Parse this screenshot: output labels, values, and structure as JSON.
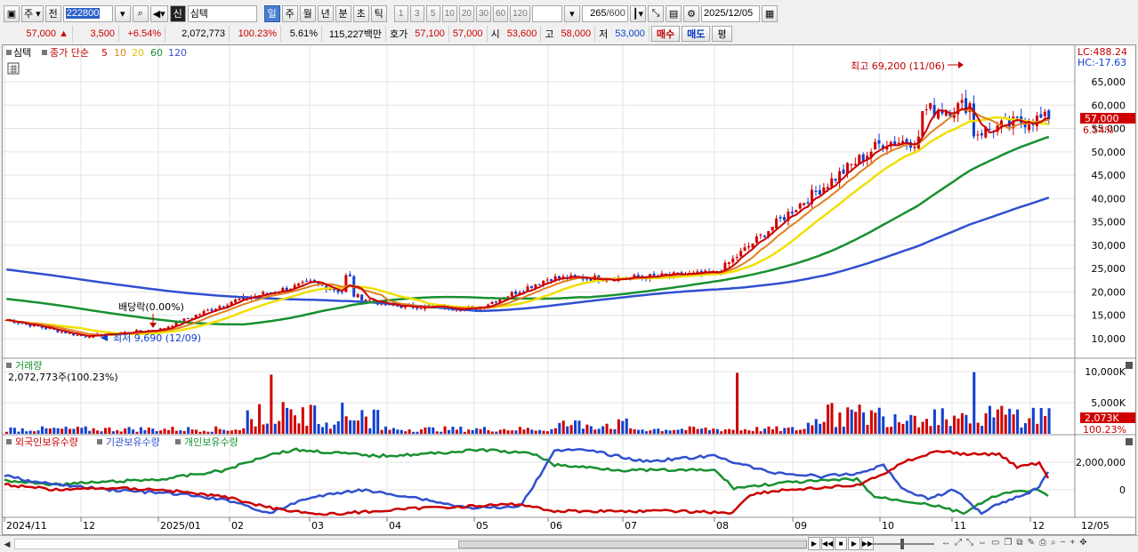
{
  "toolbar": {
    "period_type": "주",
    "prev_label": "전",
    "code": "222800",
    "market_badge": "신",
    "stock_name": "심텍",
    "period_buttons": [
      "일",
      "주",
      "월",
      "년",
      "분",
      "초",
      "틱"
    ],
    "active_period": "일",
    "interval_buttons": [
      "1",
      "3",
      "5",
      "10",
      "20",
      "30",
      "60",
      "120"
    ],
    "count": "265",
    "count_max": "/600",
    "date": "2025/12/05"
  },
  "quote": {
    "price": "57,000",
    "arrow": "▲",
    "change": "3,500",
    "change_pct": "+6.54%",
    "volume": "2,072,773",
    "volume_ratio": "100.23%",
    "turnover": "5.61%",
    "amount": "115,227백만",
    "ask_label": "호가",
    "ask": "57,100",
    "bid": "57,000",
    "open_label": "시",
    "open": "53,600",
    "high_label": "고",
    "high": "58,000",
    "low_label": "저",
    "low": "53,000",
    "buy_label": "매수",
    "sell_label": "매도",
    "eval_label": "평"
  },
  "price_panel": {
    "legend_name": "심텍",
    "legend_ma_title": "종가 단순",
    "ma_periods": [
      {
        "label": "5",
        "color": "#cc0000"
      },
      {
        "label": "10",
        "color": "#e08020"
      },
      {
        "label": "20",
        "color": "#e0d000"
      },
      {
        "label": "60",
        "color": "#189030"
      },
      {
        "label": "120",
        "color": "#3050d0"
      }
    ],
    "lc_label": "LC:488.24",
    "hc_label": "HC:-17.63",
    "current_price_tag": "57,000",
    "current_pct_tag": "6.54%",
    "high_annotation": "최고 69,200 (11/06)",
    "low_annotation": "최저 9,690 (12/09)",
    "dividend_annotation": "배당락(0.00%)",
    "y_ticks": [
      "65,000",
      "60,000",
      "55,000",
      "50,000",
      "45,000",
      "40,000",
      "35,000",
      "30,000",
      "25,000",
      "20,000",
      "15,000",
      "10,000"
    ]
  },
  "volume_panel": {
    "title": "거래량",
    "value_label": "2,072,773주(100.23%)",
    "y_ticks": [
      "10,000K",
      "5,000K"
    ],
    "current_tag": "2,073K",
    "current_pct": "100.23%"
  },
  "holding_panel": {
    "legends": [
      {
        "label": "외국인보유수량",
        "color": "#cc0000"
      },
      {
        "label": "기관보유수량",
        "color": "#3050d0"
      },
      {
        "label": "개인보유수량",
        "color": "#189030"
      }
    ],
    "y_ticks": [
      "2,000,000",
      "0"
    ]
  },
  "x_axis": {
    "labels": [
      "2024/11",
      "12",
      "2025/01",
      "02",
      "03",
      "04",
      "05",
      "06",
      "07",
      "08",
      "09",
      "10",
      "11",
      "12"
    ],
    "right_label": "12/05"
  },
  "colors": {
    "up": "#d00000",
    "down": "#1040d0",
    "grid": "#e4e4e4"
  },
  "chart_data": {
    "type": "candlestick",
    "period": "daily",
    "approx_close_by_month": [
      {
        "month": "2024/11",
        "close": 14000
      },
      {
        "month": "2024/12",
        "close": 10500
      },
      {
        "month": "2025/01",
        "close": 12000
      },
      {
        "month": "2025/02",
        "close": 18000
      },
      {
        "month": "2025/03",
        "close": 22000
      },
      {
        "month": "2025/04",
        "close": 17000
      },
      {
        "month": "2025/05",
        "close": 16500
      },
      {
        "month": "2025/06",
        "close": 23000
      },
      {
        "month": "2025/07",
        "close": 23000
      },
      {
        "month": "2025/08",
        "close": 24000
      },
      {
        "month": "2025/09",
        "close": 38000
      },
      {
        "month": "2025/10",
        "close": 52000
      },
      {
        "month": "2025/11",
        "close": 53000
      },
      {
        "month": "2025/12",
        "close": 57000
      }
    ],
    "ma_end_values": {
      "ma5": 54000,
      "ma10": 54500,
      "ma20": 55000,
      "ma60": 49000,
      "ma120": 36500
    },
    "high": {
      "value": 69200,
      "date": "11/06"
    },
    "low": {
      "value": 9690,
      "date": "12/09"
    },
    "ylim": [
      8000,
      70000
    ],
    "grid": true
  }
}
